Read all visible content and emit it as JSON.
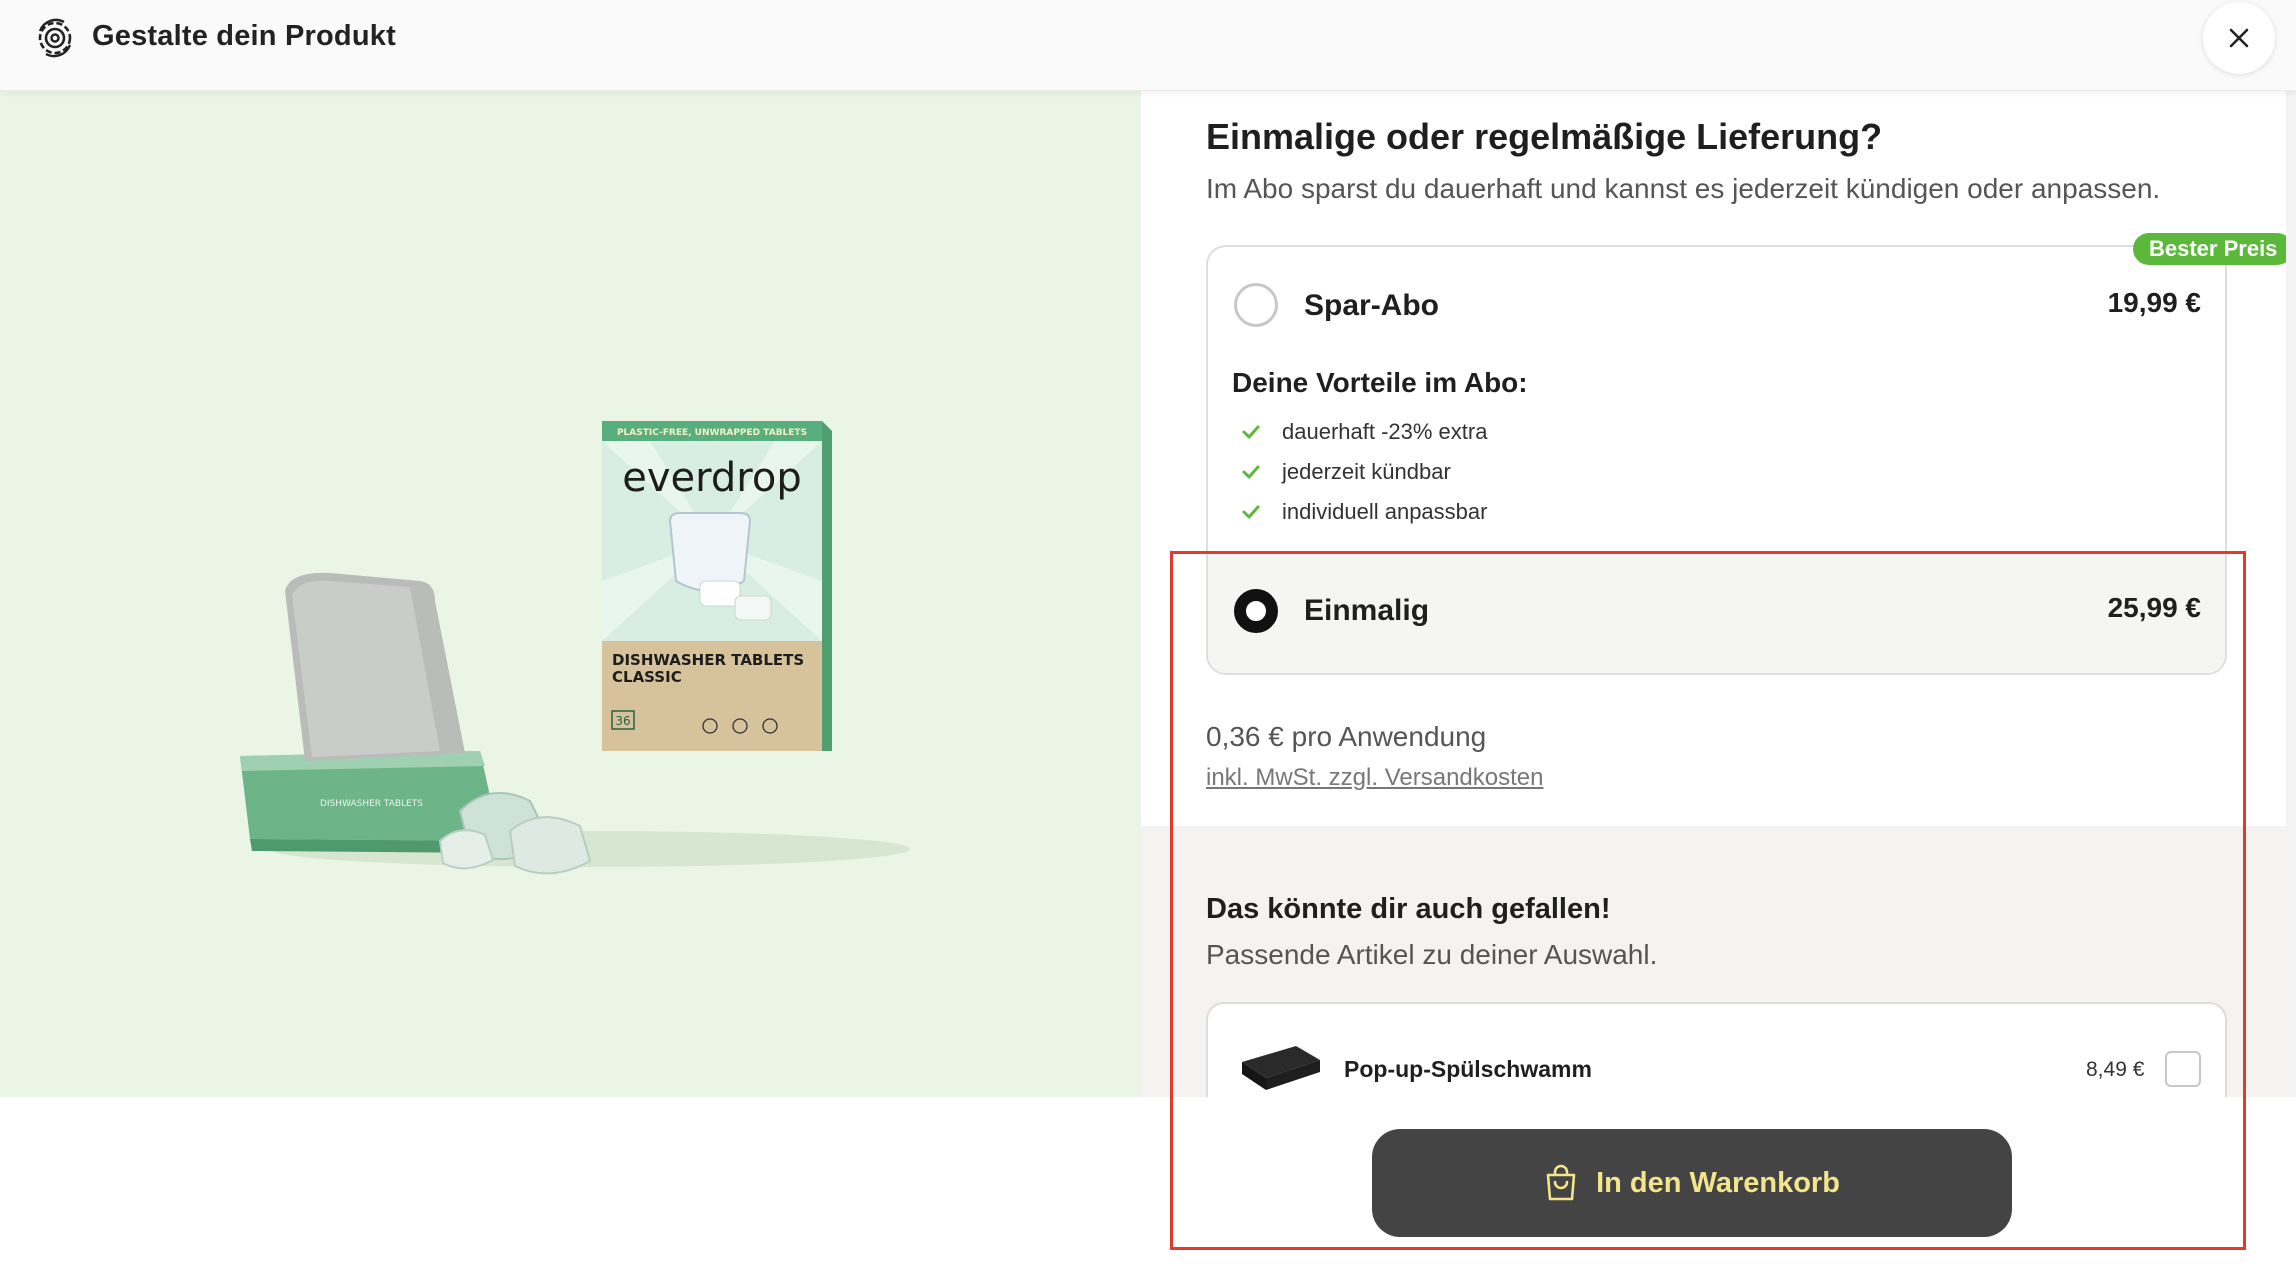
{
  "header": {
    "title": "Gestalte dein Produkt",
    "icon": "gear-refresh-icon",
    "close_icon": "close-icon"
  },
  "product_image": {
    "brand_text": "everdrop",
    "box_banner": "PLASTIC-FREE, UNWRAPPED TABLETS",
    "box_title": "DISHWASHER TABLETS CLASSIC",
    "box_count": "36",
    "background_color": "#eaf5e6"
  },
  "delivery": {
    "title": "Einmalige oder regelmäßige Lieferung?",
    "subtitle": "Im Abo sparst du dauerhaft und kannst es jederzeit kündigen oder anpassen.",
    "badge": "Bester Preis",
    "subscription": {
      "label": "Spar-Abo",
      "price": "19,99 €",
      "selected": false,
      "benefits_title": "Deine Vorteile im Abo:",
      "benefits": [
        "dauerhaft -23% extra",
        "jederzeit kündbar",
        "individuell anpassbar"
      ]
    },
    "one_time": {
      "label": "Einmalig",
      "price": "25,99 €",
      "selected": true
    }
  },
  "pricing": {
    "per_use": "0,36 € pro Anwendung",
    "tax_note": "inkl. MwSt. zzgl. Versandkosten"
  },
  "upsell": {
    "title": "Das könnte dir auch gefallen!",
    "subtitle": "Passende Artikel zu deiner Auswahl.",
    "items": [
      {
        "name": "Pop-up-Spülschwamm",
        "price": "8,49 €",
        "checked": false
      }
    ]
  },
  "cart_button": {
    "label": "In den Warenkorb",
    "icon": "shopping-bag-icon"
  },
  "colors": {
    "accent_green": "#5cb83a",
    "button_bg": "#444444",
    "button_text": "#f3e58b",
    "highlight": "#e23b2e"
  }
}
